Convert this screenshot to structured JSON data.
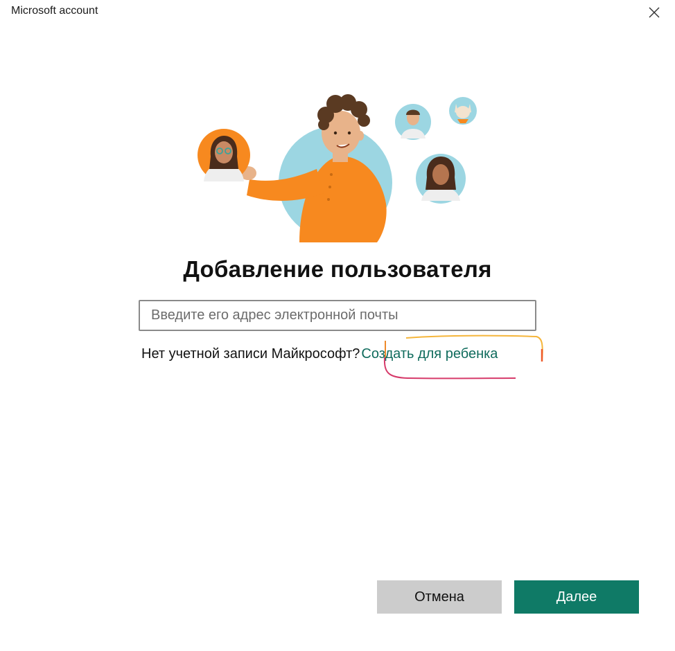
{
  "window": {
    "title": "Microsoft account"
  },
  "hero": {
    "illustration": "people-add-user-illustration",
    "colors": {
      "orange": "#f7891f",
      "teal_circle": "#9cd6e2",
      "skin": "#e8b38a",
      "hair": "#5a3a22"
    }
  },
  "main": {
    "heading": "Добавление пользователя",
    "email_input": {
      "placeholder": "Введите его адрес электронной почты",
      "value": ""
    },
    "no_account_text": "Нет учетной записи Майкрософт?",
    "create_child_link": "Создать для ребенка",
    "link_color": "#0f6b5c"
  },
  "footer": {
    "cancel_label": "Отмена",
    "next_label": "Далее",
    "next_color": "#0f7a66",
    "cancel_color": "#cccccc"
  }
}
